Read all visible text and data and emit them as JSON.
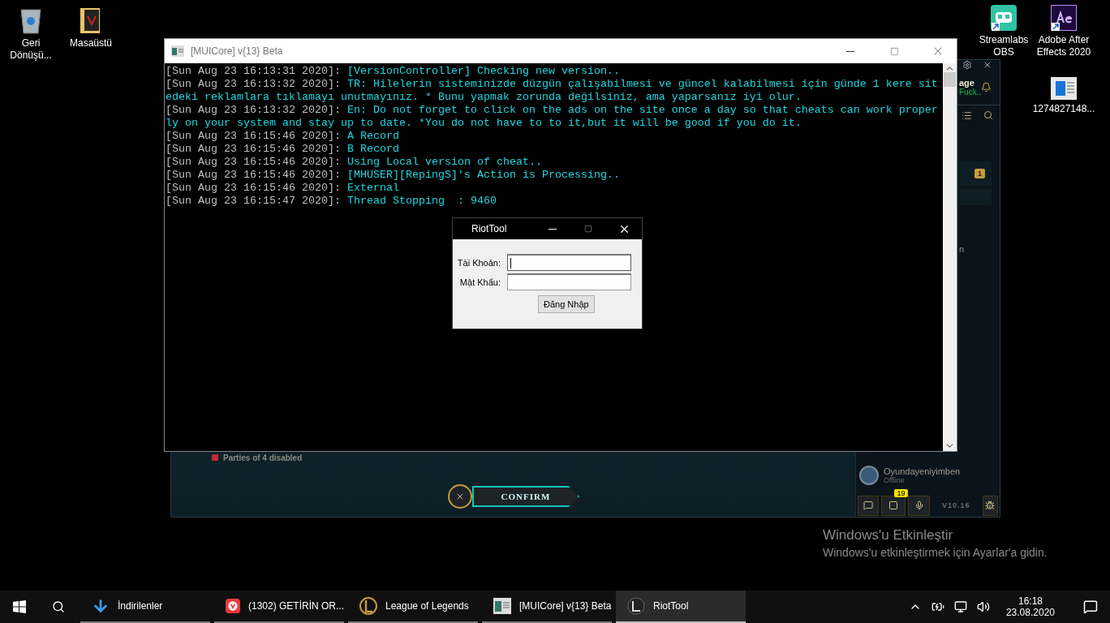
{
  "desktop_icons": [
    {
      "kind": "recycle-bin",
      "label": "Geri Dönüşü..."
    },
    {
      "kind": "folder",
      "label": "Masaüstü"
    },
    {
      "kind": "streamlabs",
      "label": "Streamlabs OBS"
    },
    {
      "kind": "after-effects",
      "label": "Adobe After Effects 2020"
    },
    {
      "kind": "document",
      "label": "1274827148..."
    }
  ],
  "game_client": {
    "profile_name": "age",
    "status": "Fuck..",
    "notification_count": "1",
    "side_text": "n",
    "party_notice": "Parties of 4 disabled",
    "confirm_button": "CONFIRM",
    "friend": {
      "name": "Oyundayeniyimben",
      "status": "Offline"
    },
    "chat_badge": "19",
    "version": "V10.16"
  },
  "console_window": {
    "title": "[MUICore] v{13} Beta",
    "lines": [
      {
        "time": "[Sun Aug 23 16:13:31 2020]:",
        "message": "[VersionController] Checking new version.."
      },
      {
        "time": "[Sun Aug 23 16:13:32 2020]:",
        "message": "TR: Hilelerin sisteminizde düzgün çalışabilmesi ve güncel kalabilmesi için günde 1 kere sitedeki reklamlara tıklamayı unutmayınız. * Bunu yapmak zorunda değilsiniz, ama yaparsanız iyi olur."
      },
      {
        "time": "[Sun Aug 23 16:13:32 2020]:",
        "message": "En: Do not forget to click on the ads on the site once a day so that cheats can work properly on your system and stay up to date. *You do not have to to it,but it will be good if you do it."
      },
      {
        "time": "[Sun Aug 23 16:15:46 2020]:",
        "message": "A Record"
      },
      {
        "time": "[Sun Aug 23 16:15:46 2020]:",
        "message": "B Record"
      },
      {
        "time": "[Sun Aug 23 16:15:46 2020]:",
        "message": "Using Local version of cheat.."
      },
      {
        "time": "[Sun Aug 23 16:15:46 2020]:",
        "message": "[MHUSER][RepingS]'s Action is Processing.."
      },
      {
        "time": "[Sun Aug 23 16:15:46 2020]:",
        "message": "External"
      },
      {
        "time": "[Sun Aug 23 16:15:47 2020]:",
        "message": "Thread Stopping  : 9460"
      }
    ]
  },
  "login_dialog": {
    "title": "RiotTool",
    "fields": [
      {
        "label": "Tài Khoản:",
        "focused": true
      },
      {
        "label": "Mật Khẩu:",
        "focused": false
      }
    ],
    "button": "Đăng Nhập"
  },
  "activation_notice": {
    "title": "Windows'u Etkinleştir",
    "message": "Windows'u etkinleştirmek için Ayarlar'a gidin."
  },
  "taskbar": {
    "items": [
      {
        "kind": "download",
        "label": "İndirilenler",
        "selected": false
      },
      {
        "kind": "browser",
        "label": "(1302) GETİRİN OR...",
        "selected": false
      },
      {
        "kind": "game",
        "label": "League of Legends",
        "selected": false
      },
      {
        "kind": "console",
        "label": "[MUICore] v{13} Beta",
        "selected": false
      },
      {
        "kind": "riot",
        "label": "RiotTool",
        "selected": true
      }
    ],
    "time": "16:18",
    "date": "23.08.2020"
  }
}
